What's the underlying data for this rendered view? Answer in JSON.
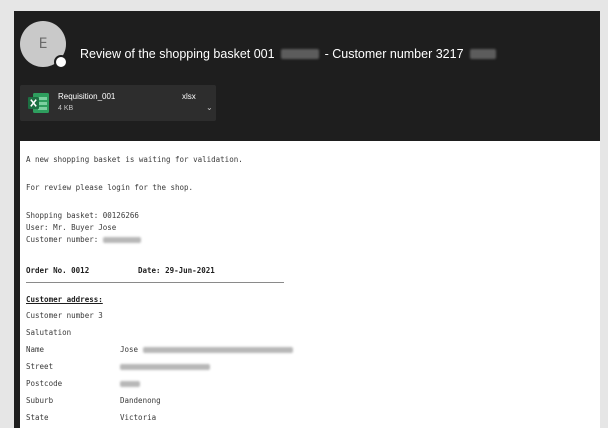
{
  "email": {
    "sender_initial": "E",
    "subject_prefix": "Review of the shopping basket 001",
    "subject_suffix": "- Customer number 3217"
  },
  "attachment": {
    "file_name": "Requisition_001",
    "extension": "xlsx",
    "size": "4 KB"
  },
  "body": {
    "line1": "A new shopping basket is waiting for validation.",
    "line2": "For review please login for the shop.",
    "basket_line": "Shopping basket: 00126266",
    "user_line": "User: Mr. Buyer Jose",
    "customer_number_label": "Customer number:",
    "order_no_label": "Order No. 0012",
    "date_label": "Date: 29-Jun-2021",
    "customer_address_heading": "Customer address:",
    "customer_number_row": "Customer number 3",
    "salutation_label": "Salutation",
    "name_label": "Name",
    "name_value": "Jose",
    "street_label": "Street",
    "postcode_label": "Postcode",
    "suburb_label": "Suburb",
    "suburb_value": "Dandenong",
    "state_label": "State",
    "state_value": "Victoria"
  },
  "colors": {
    "window_background": "#1e1e1e",
    "attachment_chip": "#2d2d2d",
    "excel_green": "#1d6f42",
    "body_background": "#ffffff"
  },
  "icons": {
    "attachment_type": "excel-file-icon",
    "attachment_menu": "chevron-down-icon"
  }
}
